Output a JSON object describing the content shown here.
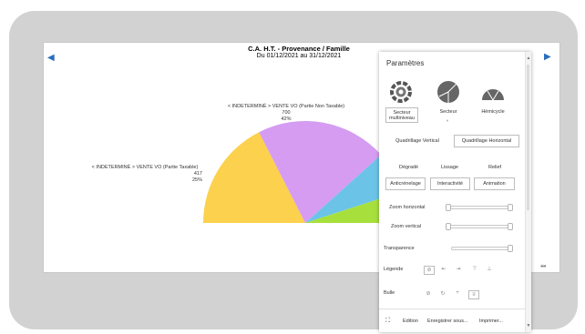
{
  "chart": {
    "title": "C.A. H.T. - Provenance / Famille",
    "subtitle": "Du 01/12/2021 au 31/12/2021"
  },
  "chart_data": {
    "type": "pie",
    "variant": "semicircle",
    "slices": [
      {
        "label": "< INDETERMINÉ > VENTE VO (Partie Taxable)",
        "value": 417,
        "percent": "25%",
        "color": "#fcd14d"
      },
      {
        "label": "< INDETERMINÉ > VENTE VO (Partie Non Taxable)",
        "value": 700,
        "percent": "42%",
        "color": "#d59cf2"
      },
      {
        "label": "",
        "value": null,
        "percent": "",
        "color": "#6bc4e8"
      },
      {
        "label": "",
        "value": null,
        "percent": "",
        "color": "#a7e03d"
      }
    ]
  },
  "params": {
    "title": "Paramètres",
    "types": [
      {
        "label": "Secteur multiniveau",
        "icon": "donut-icon"
      },
      {
        "label": "Secteur",
        "icon": "pie-icon"
      },
      {
        "label": "Hémicycle",
        "icon": "semicircle-icon"
      }
    ],
    "grid": {
      "vertical": "Quadrillage Vertical",
      "horizontal": "Quadrillage Horizontal"
    },
    "effects": {
      "gradient": "Dégradé",
      "smoothing": "Lissage",
      "relief": "Relief"
    },
    "toggles": {
      "antialias": "Anticrénelage",
      "interactivity": "Interactivité",
      "animation": "Animation"
    },
    "zoom_h": "Zoom horizontal",
    "zoom_v": "Zoom vertical",
    "transparency": "Transparence",
    "legend": "Légende",
    "bubble": "Bulle",
    "footer": {
      "edit": "Edition",
      "save": "Enregistrer sous...",
      "print": "Imprimer..."
    }
  }
}
